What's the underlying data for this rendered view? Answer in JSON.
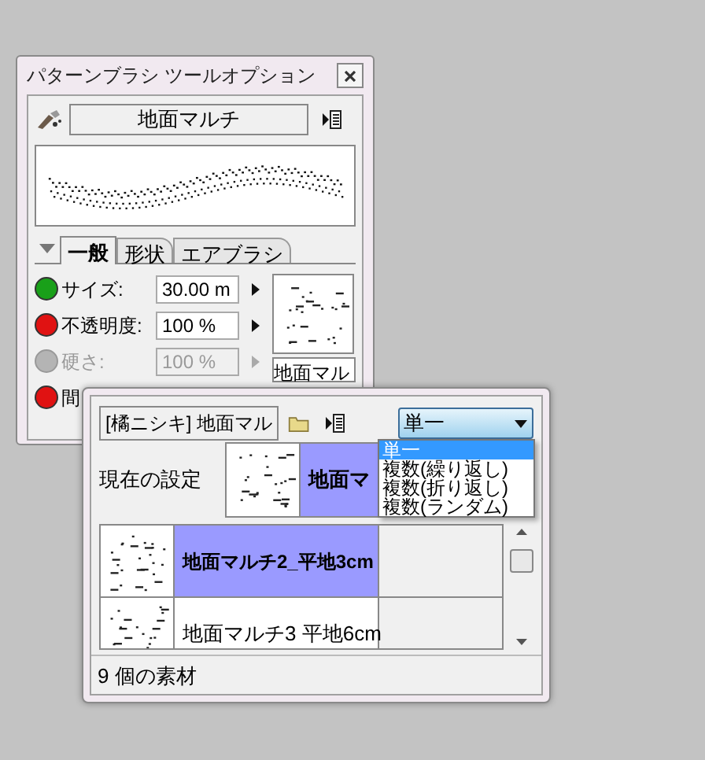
{
  "brush_window": {
    "title": "パターンブラシ ツールオプション",
    "brush_name": "地面マルチ",
    "tabs": [
      {
        "label": "一般",
        "selected": true
      },
      {
        "label": "形状",
        "selected": false
      },
      {
        "label": "エアブラシ",
        "selected": false
      }
    ],
    "settings": [
      {
        "kind": "field",
        "label": "サイズ:",
        "value": "30.00 m",
        "color": "#19a019",
        "disabled": false
      },
      {
        "kind": "field",
        "label": "不透明度:",
        "value": "100 %",
        "color": "#e01212",
        "disabled": false
      },
      {
        "kind": "field",
        "label": "硬さ:",
        "value": "100 %",
        "color": "#b4b4b4",
        "disabled": true
      },
      {
        "kind": "hidden",
        "label": "間",
        "color": "#e01212",
        "disabled": false
      }
    ],
    "thumbnail_label": "地面マル"
  },
  "material_window": {
    "material_set": "[橘ニシキ] 地面マル",
    "mode_select": {
      "value": "単一",
      "expanded": true,
      "options": [
        {
          "label": "単一",
          "selected": true
        },
        {
          "label": "複数(繰り返し)",
          "selected": false
        },
        {
          "label": "複数(折り返し)",
          "selected": false
        },
        {
          "label": "複数(ランダム)",
          "selected": false
        }
      ]
    },
    "current_setting": {
      "label": "現在の設定",
      "name": "地面マ"
    },
    "materials": [
      {
        "name": "地面マルチ2_平地3cm",
        "selected": true
      },
      {
        "name": "地面マルチ3 平地6cm",
        "selected": false
      }
    ],
    "status": "9 個の素材"
  }
}
